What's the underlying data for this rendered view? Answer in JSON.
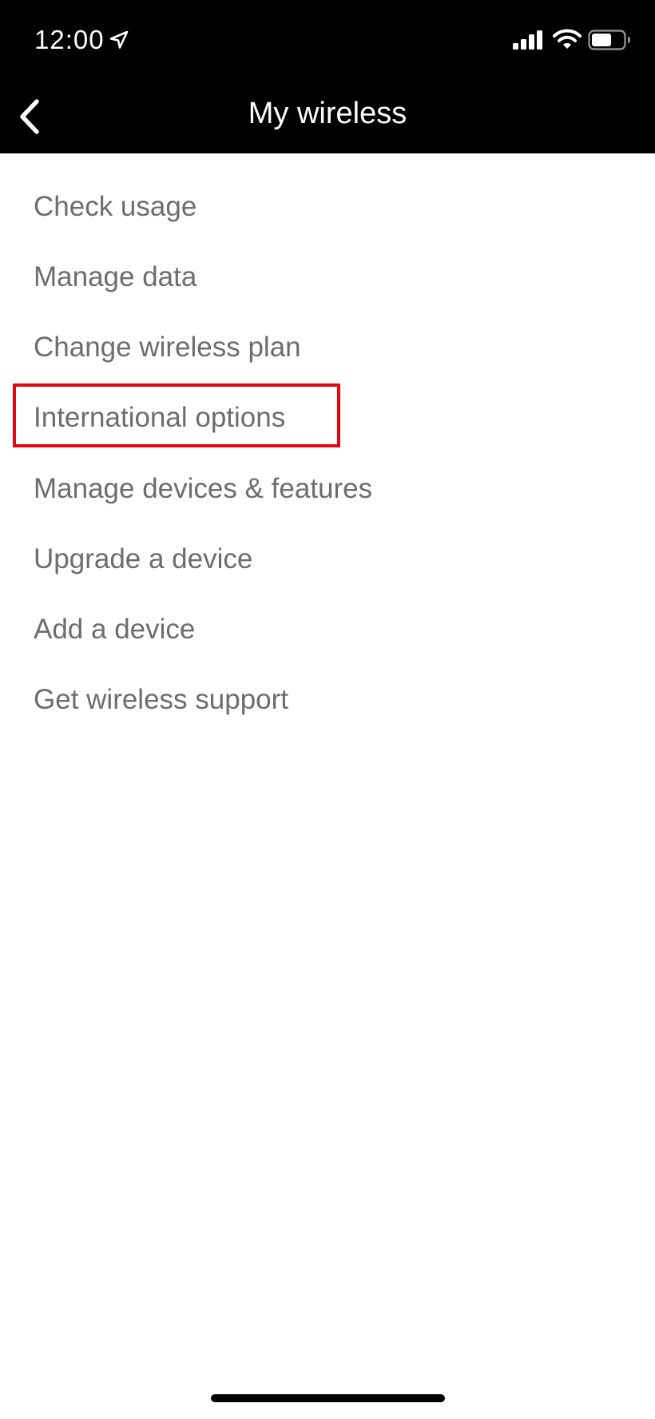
{
  "status_bar": {
    "time": "12:00",
    "icons": [
      "location-arrow-icon",
      "cellular-signal-icon",
      "wifi-icon",
      "battery-icon"
    ]
  },
  "header": {
    "title": "My wireless",
    "back_icon": "chevron-left-icon",
    "background_color": "#000000",
    "text_color": "#ffffff"
  },
  "menu": {
    "items": [
      {
        "label": "Check usage"
      },
      {
        "label": "Manage data"
      },
      {
        "label": "Change wireless plan"
      },
      {
        "label": "International options",
        "highlighted": true
      },
      {
        "label": "Manage devices & features"
      },
      {
        "label": "Upgrade a device"
      },
      {
        "label": "Add a device"
      },
      {
        "label": "Get wireless support"
      }
    ],
    "text_color": "#6d6d6d"
  },
  "highlight": {
    "color": "#e30613",
    "target": "International options"
  }
}
